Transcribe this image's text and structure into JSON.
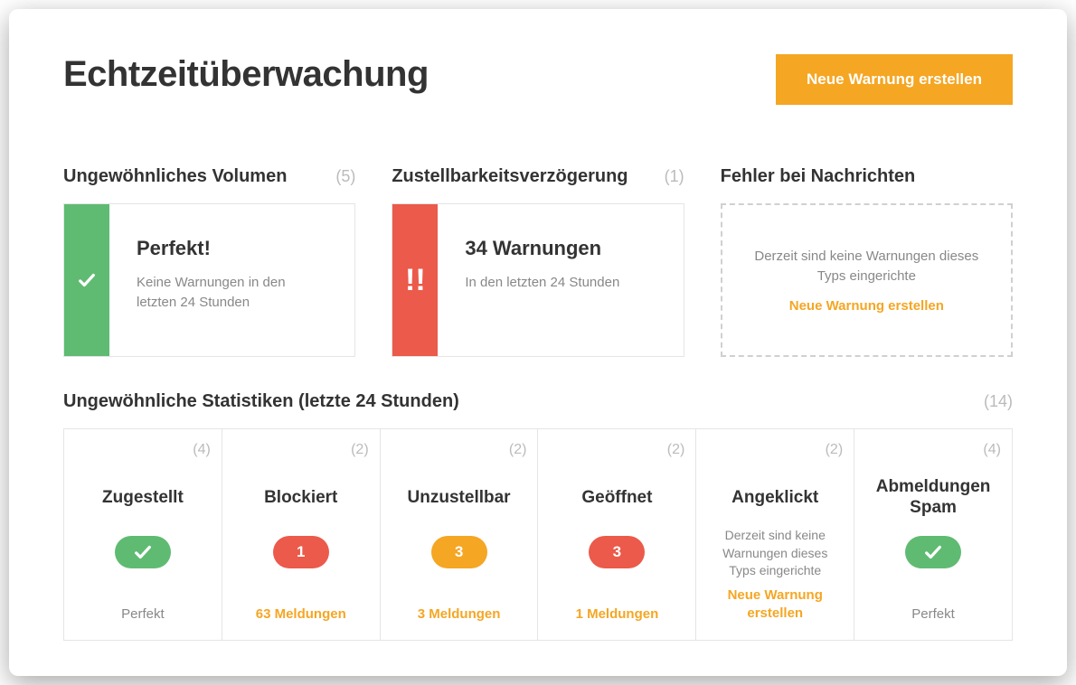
{
  "header": {
    "title": "Echtzeitüberwachung",
    "new_alert_button": "Neue Warnung erstellen"
  },
  "sections": {
    "volume": {
      "title": "Ungewöhnliches Volumen",
      "count": "5",
      "status_title": "Perfekt!",
      "status_sub": "Keine Warnungen in den letzten 24 Stunden",
      "status_kind": "ok"
    },
    "delay": {
      "title": "Zustellbarkeitsverzögerung",
      "count": "1",
      "status_title": "34 Warnungen",
      "status_sub": "In den letzten 24 Stunden",
      "status_kind": "alert"
    },
    "errors": {
      "title": "Fehler bei Nachrichten",
      "empty_text": "Derzeit sind keine Warnungen dieses Typs eingerichte",
      "empty_link": "Neue Warnung erstellen"
    }
  },
  "stats": {
    "title": "Ungewöhnliche Statistiken (letzte 24 Stunden)",
    "count": "14",
    "items": [
      {
        "name": "Zugestellt",
        "count": "4",
        "kind": "ok",
        "pill_color": "green",
        "pill_text": "",
        "footer": "Perfekt",
        "footer_style": "gray"
      },
      {
        "name": "Blockiert",
        "count": "2",
        "kind": "alert",
        "pill_color": "red",
        "pill_text": "1",
        "footer": "63 Meldungen",
        "footer_style": "orange"
      },
      {
        "name": "Unzustellbar",
        "count": "2",
        "kind": "alert",
        "pill_color": "orange",
        "pill_text": "3",
        "footer": "3 Meldungen",
        "footer_style": "orange"
      },
      {
        "name": "Geöffnet",
        "count": "2",
        "kind": "alert",
        "pill_color": "red",
        "pill_text": "3",
        "footer": "1 Meldungen",
        "footer_style": "orange"
      },
      {
        "name": "Angeklickt",
        "count": "2",
        "kind": "empty",
        "empty_text": "Derzeit sind keine Warnungen dieses Typs eingerichte",
        "empty_link": "Neue Warnung erstellen"
      },
      {
        "name": "Abmeldungen Spam",
        "count": "4",
        "kind": "ok",
        "pill_color": "green",
        "pill_text": "",
        "footer": "Perfekt",
        "footer_style": "gray"
      }
    ]
  },
  "icons": {
    "check": "check-icon",
    "alert": "alert-icon"
  }
}
